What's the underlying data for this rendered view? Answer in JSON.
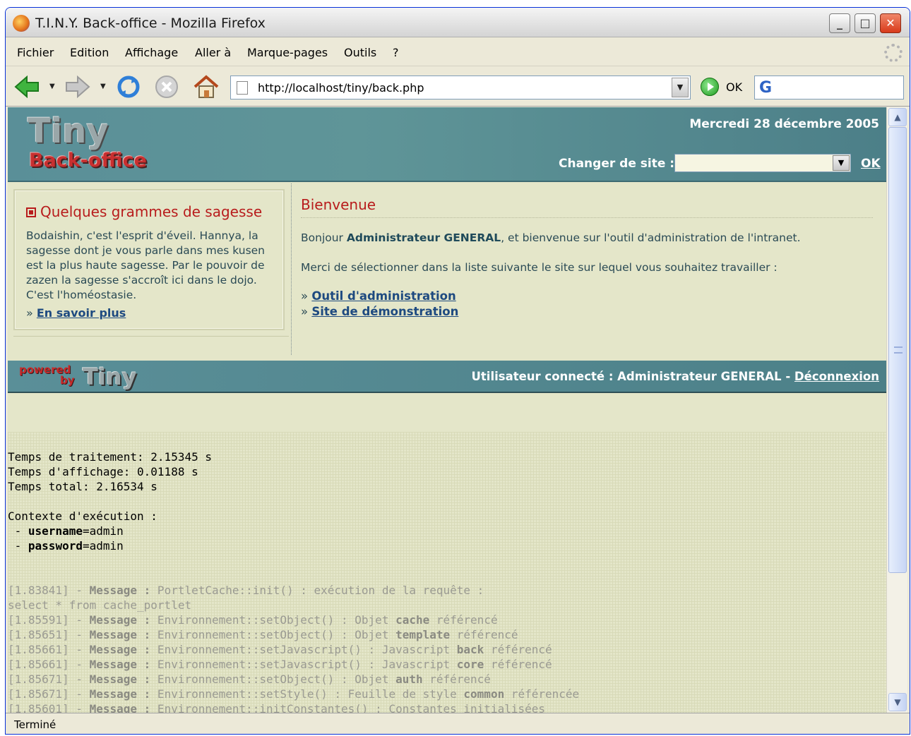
{
  "window": {
    "title": "T.I.N.Y. Back-office - Mozilla Firefox",
    "min_glyph": "_",
    "max_glyph": "□",
    "close_glyph": "✕"
  },
  "menu": [
    "Fichier",
    "Edition",
    "Affichage",
    "Aller à",
    "Marque-pages",
    "Outils",
    "?"
  ],
  "navbar": {
    "url": "http://localhost/tiny/back.php",
    "go_label": "OK",
    "search_value": ""
  },
  "header": {
    "logo_title": "Tiny",
    "logo_subtitle": "Back-office",
    "date": "Mercredi 28 décembre 2005",
    "change_site_label": "Changer de site :",
    "site_select_value": "",
    "ok_label": "OK"
  },
  "wisdom": {
    "title": "Quelques grammes de sagesse",
    "text": "Bodaishin, c'est l'esprit d'éveil. Hannya, la sagesse dont je vous parle dans mes kusen est la plus haute sagesse. Par le pouvoir de zazen la sagesse s'accroît ici dans le dojo. C'est l'homéostasie.",
    "more_prefix": "» ",
    "more_label": "En savoir plus"
  },
  "welcome": {
    "title": "Bienvenue",
    "greet_prefix": "Bonjour ",
    "user_name": "Administrateur GENERAL",
    "greet_suffix": ", et bienvenue sur l'outil d'administration de l'intranet.",
    "select_text": "Merci de sélectionner dans la liste suivante le site sur lequel vous souhaitez travailler :",
    "links": [
      {
        "prefix": "» ",
        "label": "Outil d'administration"
      },
      {
        "prefix": "» ",
        "label": "Site de démonstration"
      }
    ]
  },
  "footer": {
    "powered": "powered",
    "by": "by",
    "brand": "Tiny",
    "user_label": "Utilisateur connecté : Administrateur GENERAL",
    "separator": " - ",
    "logout": "Déconnexion"
  },
  "debug": {
    "timing": [
      "Temps de traitement: 2.15345 s",
      "Temps d'affichage: 0.01188 s",
      "Temps total: 2.16534 s"
    ],
    "context_title": "Contexte d'exécution :",
    "context": [
      {
        "prefix": " - ",
        "key": "username",
        "value": "=admin"
      },
      {
        "prefix": " - ",
        "key": "password",
        "value": "=admin"
      }
    ],
    "log": [
      {
        "time": "[1.83841] - ",
        "kind": "Message :",
        "pre": " PortletCache::init() : exécution de la requête :",
        "strong": "",
        "post": ""
      },
      {
        "time": "select * from cache_portlet",
        "kind": "",
        "pre": "",
        "strong": "",
        "post": ""
      },
      {
        "time": "[1.85591] - ",
        "kind": "Message :",
        "pre": " Environnement::setObject() : Objet ",
        "strong": "cache",
        "post": " référencé"
      },
      {
        "time": "[1.85651] - ",
        "kind": "Message :",
        "pre": " Environnement::setObject() : Objet ",
        "strong": "template",
        "post": " référencé"
      },
      {
        "time": "[1.85661] - ",
        "kind": "Message :",
        "pre": " Environnement::setJavascript() : Javascript ",
        "strong": "back",
        "post": " référencé"
      },
      {
        "time": "[1.85661] - ",
        "kind": "Message :",
        "pre": " Environnement::setJavascript() : Javascript ",
        "strong": "core",
        "post": " référencé"
      },
      {
        "time": "[1.85671] - ",
        "kind": "Message :",
        "pre": " Environnement::setObject() : Objet ",
        "strong": "auth",
        "post": " référencé"
      },
      {
        "time": "[1.85671] - ",
        "kind": "Message :",
        "pre": " Environnement::setStyle() : Feuille de style ",
        "strong": "common",
        "post": " référencée"
      },
      {
        "time": "[1.85601] - ",
        "kind": "Message :",
        "pre": " Environnement::initConstantes() : Constantes initialisées",
        "strong": "",
        "post": ""
      }
    ]
  },
  "status": {
    "text": "Terminé"
  }
}
